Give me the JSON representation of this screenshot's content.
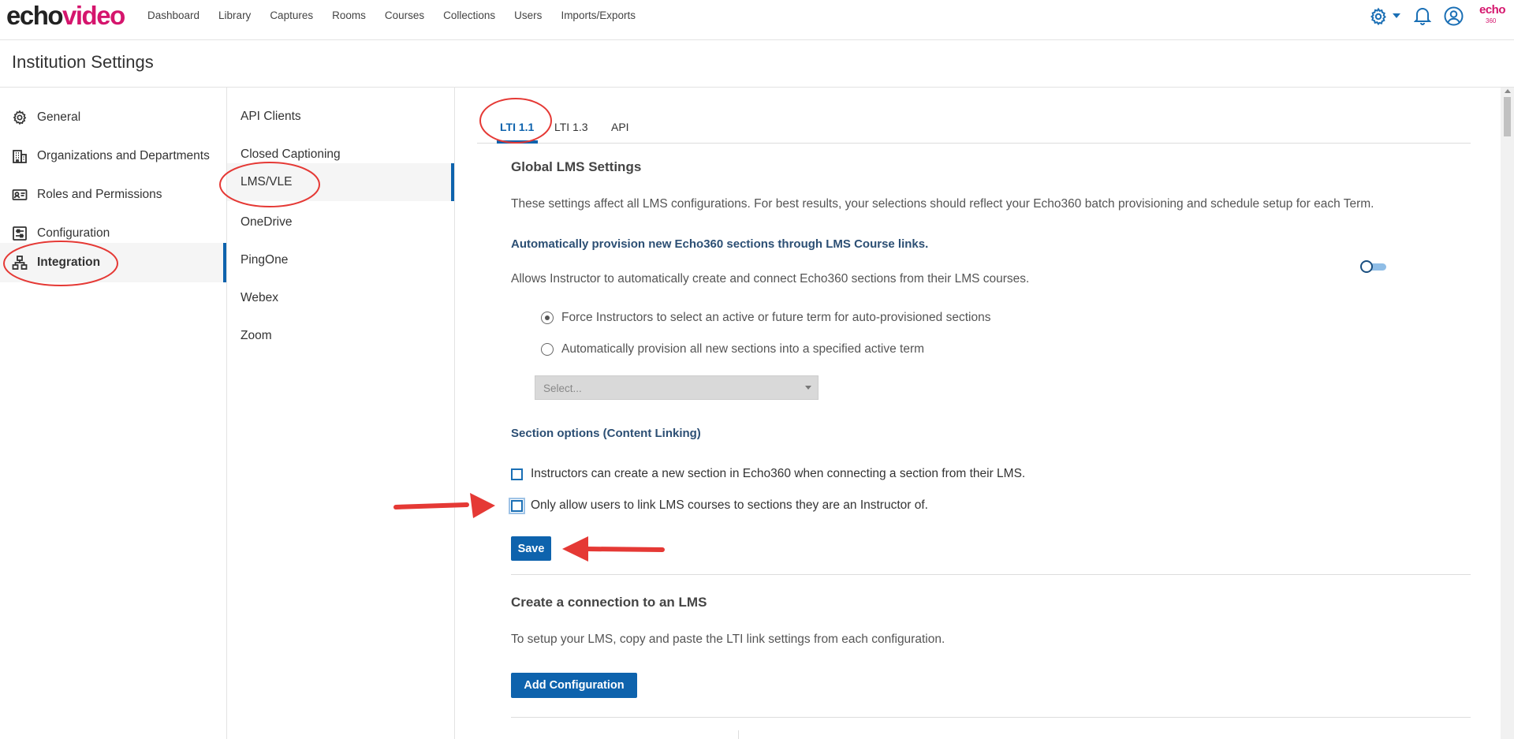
{
  "brand": {
    "logo_part1": "echo",
    "logo_part2": "video",
    "mini_logo": "echo",
    "mini_logo_sub": "360"
  },
  "nav": {
    "items": [
      "Dashboard",
      "Library",
      "Captures",
      "Rooms",
      "Courses",
      "Collections",
      "Users",
      "Imports/Exports"
    ]
  },
  "header_icons": [
    "gear-icon",
    "bell-icon",
    "user-circle-icon"
  ],
  "page": {
    "title": "Institution Settings"
  },
  "sidebar": {
    "items": [
      {
        "label": "General",
        "icon": "gear-icon"
      },
      {
        "label": "Organizations and Departments",
        "icon": "building-icon"
      },
      {
        "label": "Roles and Permissions",
        "icon": "id-card-icon"
      },
      {
        "label": "Configuration",
        "icon": "sliders-icon"
      },
      {
        "label": "Integration",
        "icon": "network-icon",
        "active": true
      }
    ]
  },
  "subnav": {
    "items": [
      {
        "label": "API Clients"
      },
      {
        "label": "Closed Captioning"
      },
      {
        "label": "LMS/VLE",
        "active": true
      },
      {
        "label": "OneDrive"
      },
      {
        "label": "PingOne"
      },
      {
        "label": "Webex"
      },
      {
        "label": "Zoom"
      }
    ]
  },
  "tabs": [
    {
      "label": "LTI 1.1",
      "active": true
    },
    {
      "label": "LTI 1.3"
    },
    {
      "label": "API"
    }
  ],
  "global": {
    "heading": "Global LMS Settings",
    "description": "These settings affect all LMS configurations. For best results, your selections should reflect your Echo360 batch provisioning and schedule setup for each Term.",
    "auto_title": "Automatically provision new Echo360 sections through LMS Course links.",
    "auto_desc": "Allows Instructor to automatically create and connect Echo360 sections from their LMS courses.",
    "toggle_on": false,
    "radio_1": "Force Instructors to select an active or future term for auto-provisioned sections",
    "radio_2": "Automatically provision all new sections into a specified active term",
    "select_placeholder": "Select..."
  },
  "section_options": {
    "heading": "Section options (Content Linking)",
    "check_1": "Instructors can create a new section in Echo360 when connecting a section from their LMS.",
    "check_2": "Only allow users to link LMS courses to sections they are an Instructor of.",
    "save_label": "Save"
  },
  "connection": {
    "heading": "Create a connection to an LMS",
    "description": "To setup your LMS, copy and paste the LTI link settings from each configuration.",
    "add_label": "Add Configuration"
  },
  "colors": {
    "primary": "#0e63ad",
    "brand_pink": "#d5156d",
    "annotation_red": "#e53935"
  }
}
